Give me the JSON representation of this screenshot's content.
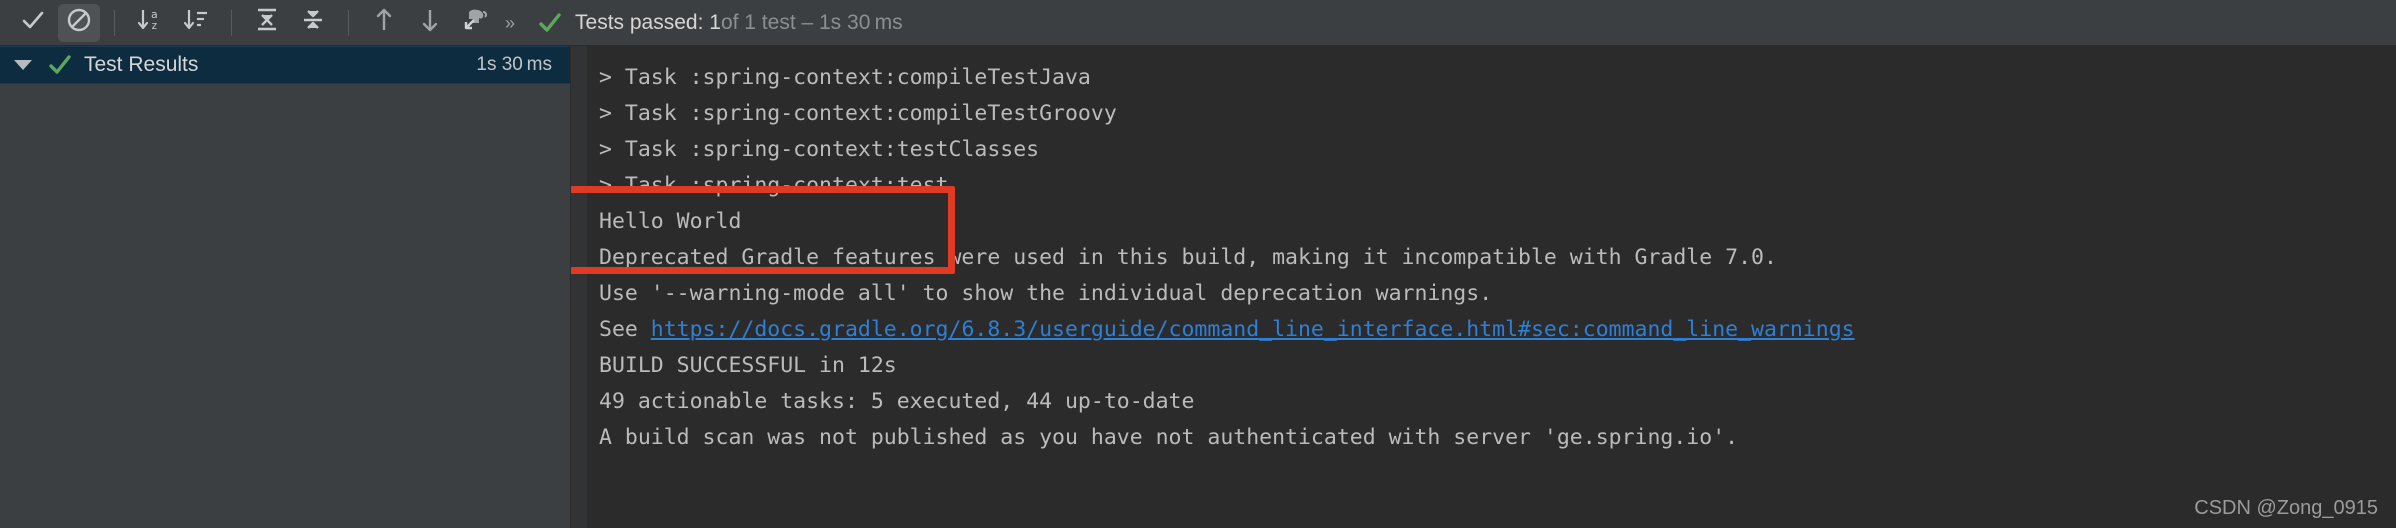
{
  "toolbar": {
    "buttons": [
      {
        "name": "show-passed-tests-button",
        "icon": "check-icon",
        "active": false
      },
      {
        "name": "show-ignored-tests-button",
        "icon": "no-entry-icon",
        "active": true
      },
      {
        "name": "sort-alphabetically-button",
        "icon": "sort-alpha-icon",
        "active": false
      },
      {
        "name": "sort-by-duration-button",
        "icon": "sort-duration-icon",
        "active": false
      },
      {
        "name": "expand-all-button",
        "icon": "expand-all-icon",
        "active": false
      },
      {
        "name": "collapse-all-button",
        "icon": "collapse-all-icon",
        "active": false
      },
      {
        "name": "previous-failed-test-button",
        "icon": "arrow-up-icon",
        "active": false
      },
      {
        "name": "next-failed-test-button",
        "icon": "arrow-down-icon",
        "active": false
      },
      {
        "name": "export-test-results-button",
        "icon": "elephant-export-icon",
        "active": false
      }
    ],
    "overflow_label": "»",
    "status": {
      "icon": "green-check-icon",
      "strong": "Tests passed: 1",
      "dim": " of 1 test – 1s 30 ms"
    }
  },
  "sidebar": {
    "tree": {
      "toggle_icon": "triangle-down-icon",
      "status_icon": "green-check-icon",
      "label": "Test Results",
      "duration": "1s 30 ms"
    }
  },
  "console": {
    "lines": [
      {
        "text": "> Task :spring-context:compileTestJava",
        "type": "plain"
      },
      {
        "text": "> Task :spring-context:compileTestGroovy",
        "type": "plain"
      },
      {
        "text": "> Task :spring-context:testClasses",
        "type": "plain"
      },
      {
        "text": "> Task :spring-context:test",
        "type": "plain"
      },
      {
        "text": "Hello World",
        "type": "plain"
      },
      {
        "text": "Deprecated Gradle features were used in this build, making it incompatible with Gradle 7.0.",
        "type": "plain"
      },
      {
        "text": "Use '--warning-mode all' to show the individual deprecation warnings.",
        "type": "plain"
      },
      {
        "prefix": "See ",
        "link": "https://docs.gradle.org/6.8.3/userguide/command_line_interface.html#sec:command_line_warnings",
        "type": "link"
      },
      {
        "text": "BUILD SUCCESSFUL in 12s",
        "type": "plain"
      },
      {
        "text": "49 actionable tasks: 5 executed, 44 up-to-date",
        "type": "plain"
      },
      {
        "text": "A build scan was not published as you have not authenticated with server 'ge.spring.io'.",
        "type": "plain"
      }
    ]
  },
  "annotation": {
    "highlight_name": "hello-world-highlight-box",
    "color": "#e03a23"
  },
  "watermark": {
    "text": "CSDN @Zong_0915"
  }
}
